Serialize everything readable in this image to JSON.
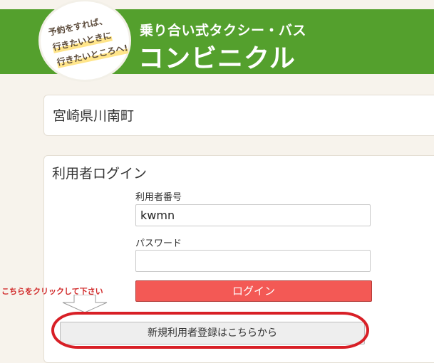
{
  "header": {
    "slogan": [
      "予約をすれば、",
      "行きたいときに",
      "行きたいところへ!"
    ],
    "brand_sub": "乗り合い式タクシー・バス",
    "brand_main": "コンビニクル"
  },
  "town": {
    "name": "宮崎県川南町"
  },
  "login": {
    "title": "利用者ログイン",
    "user_label": "利用者番号",
    "user_value": "kwmn",
    "password_label": "パスワード",
    "password_value": "",
    "login_button": "ログイン",
    "register_button": "新規利用者登録はこちらから"
  },
  "annotation": {
    "hint": "こちらをクリックして下さい"
  },
  "colors": {
    "brand_green": "#54a02d",
    "login_button": "#f35955",
    "annotation_red": "#d81f26"
  }
}
